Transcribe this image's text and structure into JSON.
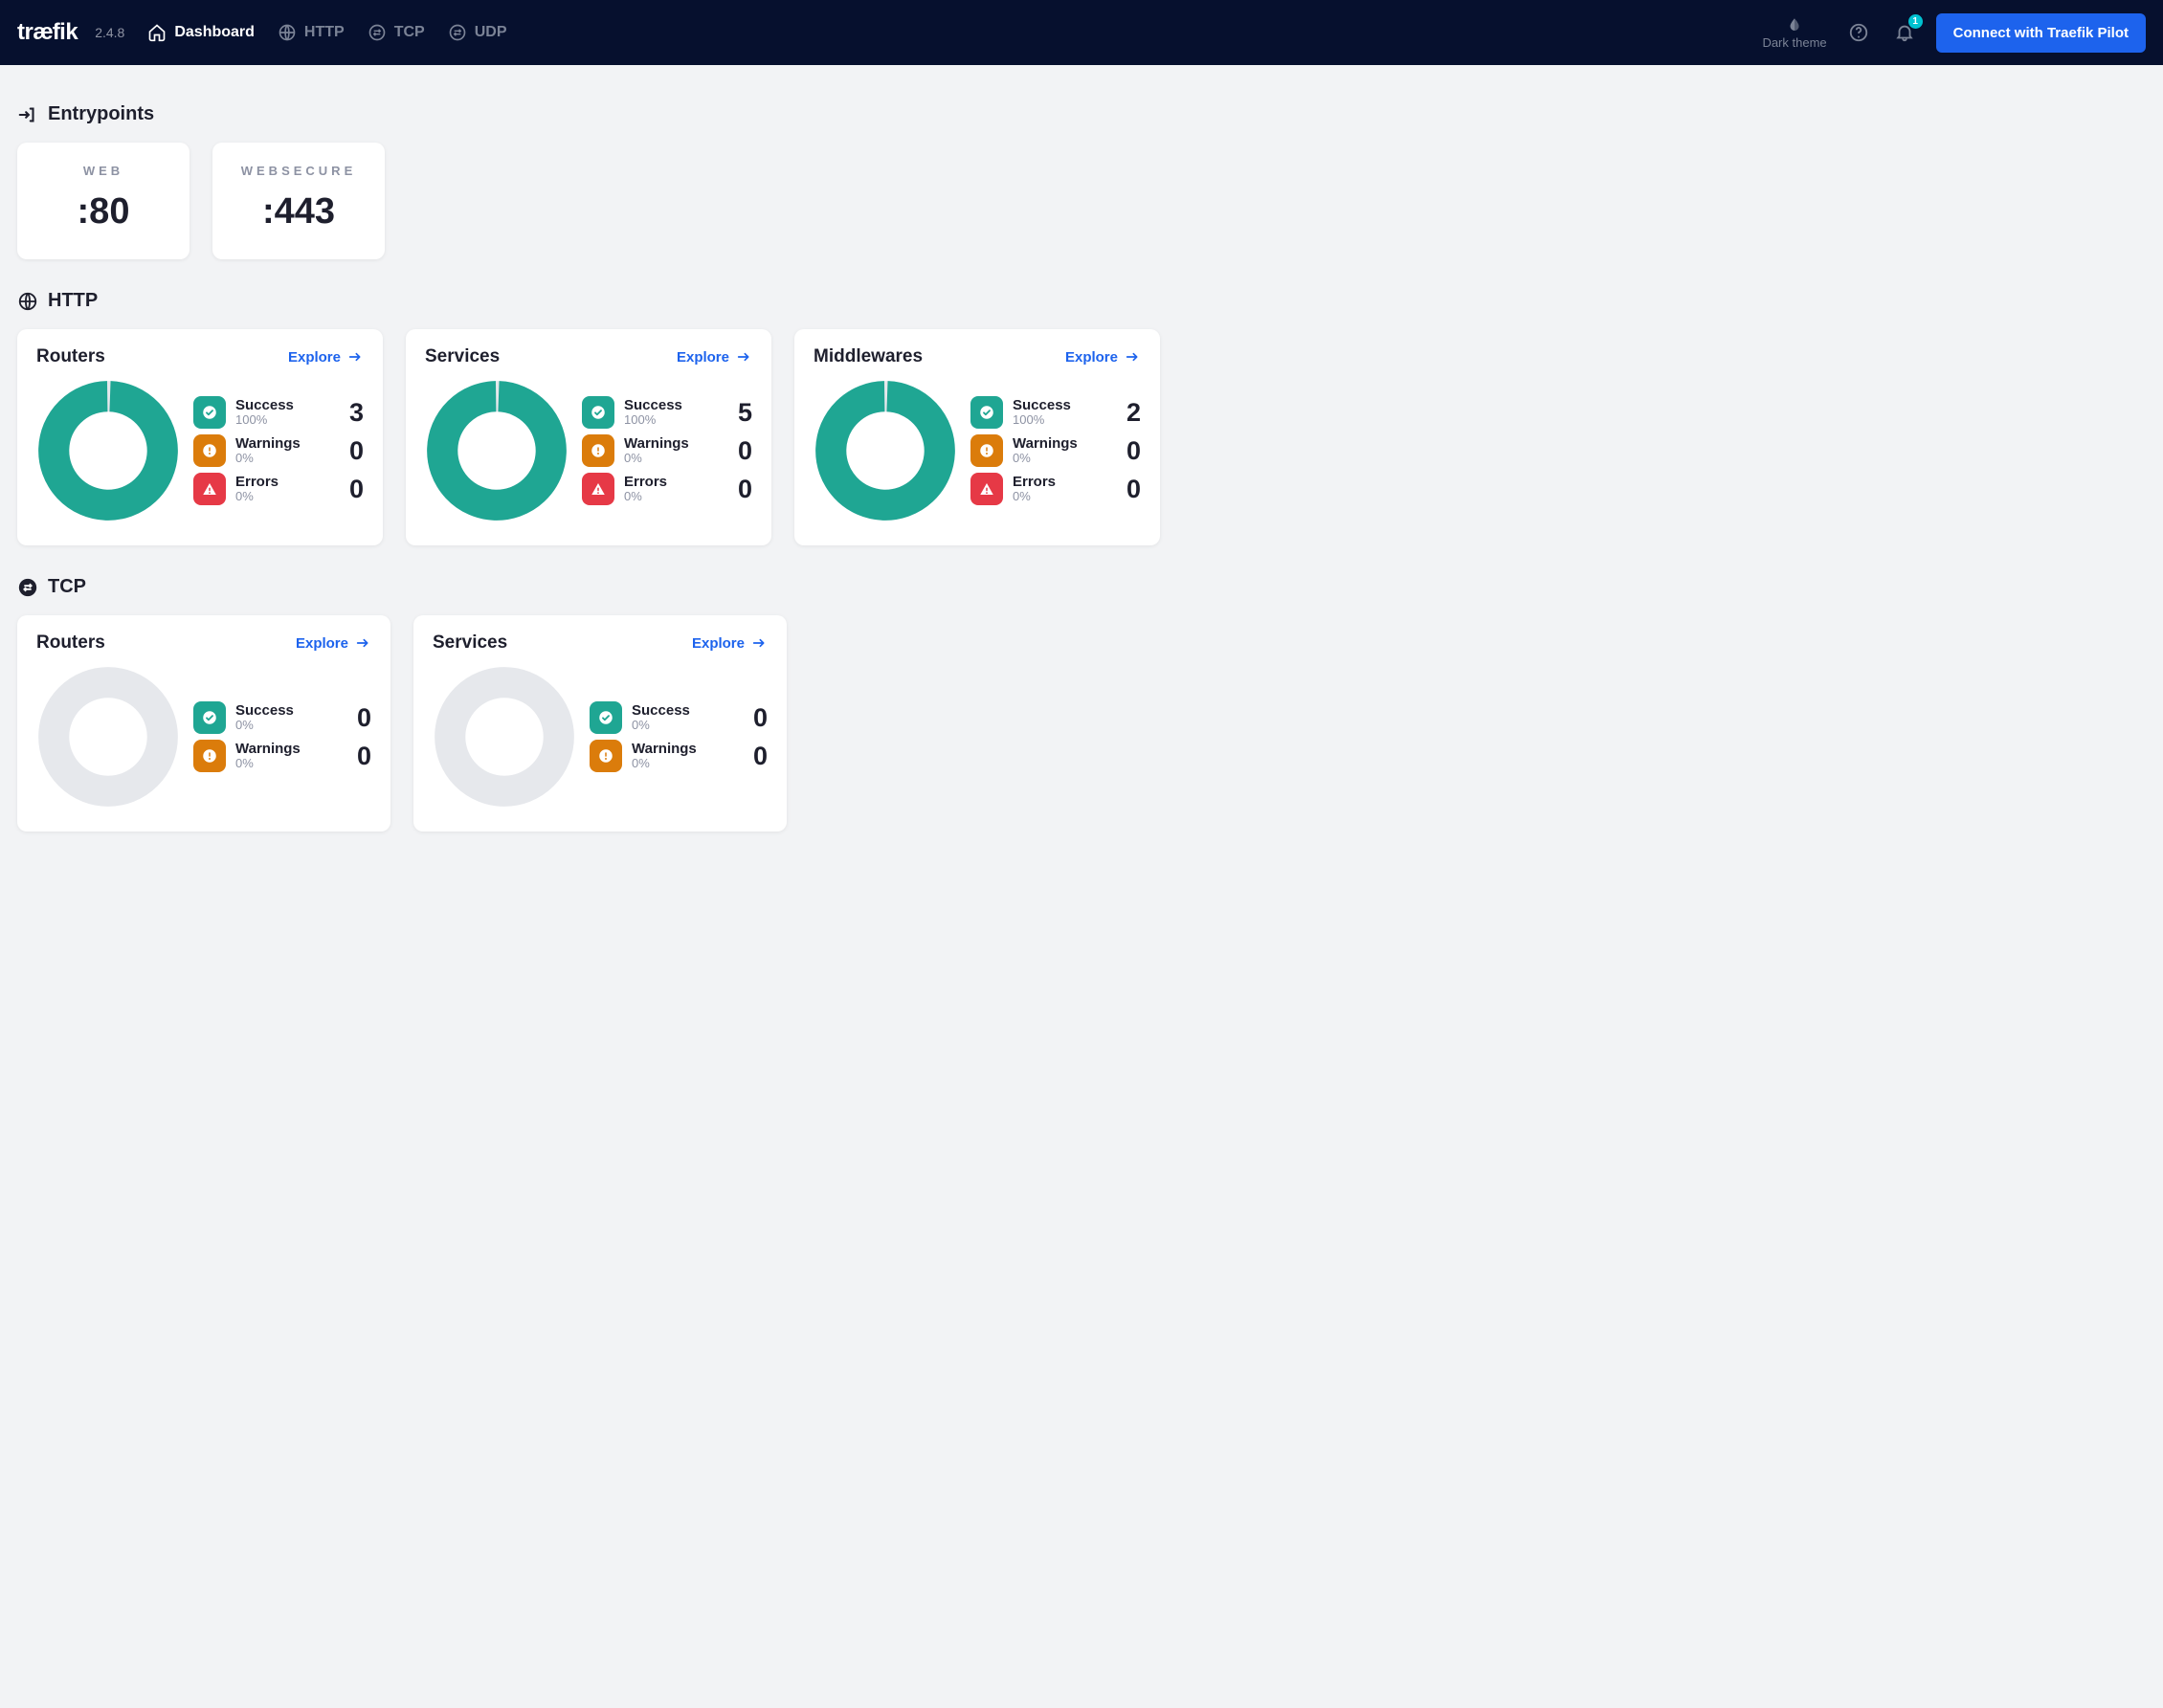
{
  "header": {
    "logo": "træfik",
    "version": "2.4.8",
    "nav": {
      "dashboard": "Dashboard",
      "http": "HTTP",
      "tcp": "TCP",
      "udp": "UDP"
    },
    "theme_label": "Dark theme",
    "bell_badge": "1",
    "pilot_button": "Connect with Traefik Pilot"
  },
  "sections": {
    "entrypoints": {
      "title": "Entrypoints"
    },
    "http": {
      "title": "HTTP"
    },
    "tcp": {
      "title": "TCP"
    }
  },
  "entrypoints": [
    {
      "name": "WEB",
      "port": ":80"
    },
    {
      "name": "WEBSECURE",
      "port": ":443"
    }
  ],
  "explore_label": "Explore",
  "stat_labels": {
    "success": "Success",
    "warnings": "Warnings",
    "errors": "Errors"
  },
  "http_cards": {
    "routers": {
      "title": "Routers",
      "success_pct": "100%",
      "success_count": "3",
      "warn_pct": "0%",
      "warn_count": "0",
      "err_pct": "0%",
      "err_count": "0"
    },
    "services": {
      "title": "Services",
      "success_pct": "100%",
      "success_count": "5",
      "warn_pct": "0%",
      "warn_count": "0",
      "err_pct": "0%",
      "err_count": "0"
    },
    "middlewares": {
      "title": "Middlewares",
      "success_pct": "100%",
      "success_count": "2",
      "warn_pct": "0%",
      "warn_count": "0",
      "err_pct": "0%",
      "err_count": "0"
    }
  },
  "tcp_cards": {
    "routers": {
      "title": "Routers",
      "success_pct": "0%",
      "success_count": "0",
      "warn_pct": "0%",
      "warn_count": "0"
    },
    "services": {
      "title": "Services",
      "success_pct": "0%",
      "success_count": "0",
      "warn_pct": "0%",
      "warn_count": "0"
    }
  },
  "chart_data": [
    {
      "section": "HTTP",
      "card": "Routers",
      "type": "donut",
      "series": [
        {
          "name": "Success",
          "value": 100,
          "color": "#1fa693"
        },
        {
          "name": "Warnings",
          "value": 0,
          "color": "#db7c0b"
        },
        {
          "name": "Errors",
          "value": 0,
          "color": "#e63946"
        }
      ],
      "counts": {
        "Success": 3,
        "Warnings": 0,
        "Errors": 0
      }
    },
    {
      "section": "HTTP",
      "card": "Services",
      "type": "donut",
      "series": [
        {
          "name": "Success",
          "value": 100,
          "color": "#1fa693"
        },
        {
          "name": "Warnings",
          "value": 0,
          "color": "#db7c0b"
        },
        {
          "name": "Errors",
          "value": 0,
          "color": "#e63946"
        }
      ],
      "counts": {
        "Success": 5,
        "Warnings": 0,
        "Errors": 0
      }
    },
    {
      "section": "HTTP",
      "card": "Middlewares",
      "type": "donut",
      "series": [
        {
          "name": "Success",
          "value": 100,
          "color": "#1fa693"
        },
        {
          "name": "Warnings",
          "value": 0,
          "color": "#db7c0b"
        },
        {
          "name": "Errors",
          "value": 0,
          "color": "#e63946"
        }
      ],
      "counts": {
        "Success": 2,
        "Warnings": 0,
        "Errors": 0
      }
    },
    {
      "section": "TCP",
      "card": "Routers",
      "type": "donut",
      "series": [
        {
          "name": "Success",
          "value": 0,
          "color": "#1fa693"
        },
        {
          "name": "Warnings",
          "value": 0,
          "color": "#db7c0b"
        },
        {
          "name": "Errors",
          "value": 0,
          "color": "#e63946"
        }
      ],
      "counts": {
        "Success": 0,
        "Warnings": 0
      }
    },
    {
      "section": "TCP",
      "card": "Services",
      "type": "donut",
      "series": [
        {
          "name": "Success",
          "value": 0,
          "color": "#1fa693"
        },
        {
          "name": "Warnings",
          "value": 0,
          "color": "#db7c0b"
        },
        {
          "name": "Errors",
          "value": 0,
          "color": "#e63946"
        }
      ],
      "counts": {
        "Success": 0,
        "Warnings": 0
      }
    }
  ]
}
